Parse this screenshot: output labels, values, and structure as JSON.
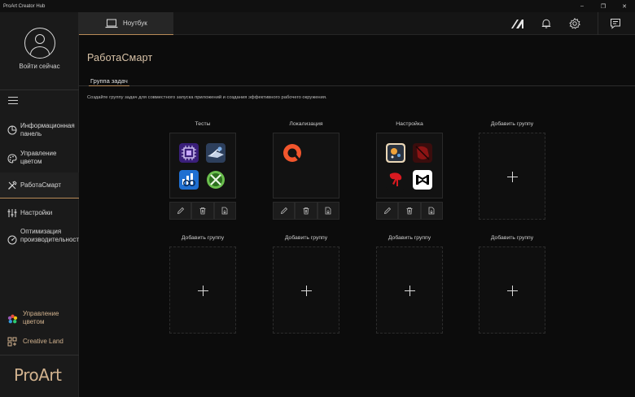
{
  "window": {
    "title": "ProArt Creator Hub",
    "controls": [
      "–",
      "❐",
      "✕"
    ]
  },
  "sidebar": {
    "login_label": "Войти сейчас",
    "items": [
      {
        "label": "Информационная панель",
        "icon": "dashboard-icon"
      },
      {
        "label": "Управление цветом",
        "icon": "palette-icon"
      },
      {
        "label": "РаботаСмарт",
        "icon": "tools-icon",
        "active": true
      },
      {
        "label": "Настройки",
        "icon": "sliders-icon"
      },
      {
        "label": "Оптимизация производительности",
        "icon": "performance-icon"
      }
    ],
    "bottom_items": [
      {
        "label": "Управление цветом",
        "icon": "color-wheel-icon"
      },
      {
        "label": "Creative Land",
        "icon": "creative-land-icon"
      }
    ],
    "logo": "ProArt"
  },
  "topbar": {
    "device_tab": "Ноутбук",
    "icons": [
      "proart-mark-icon",
      "bell-icon",
      "gear-icon",
      "feedback-icon"
    ]
  },
  "page": {
    "title": "РаботаСмарт",
    "subtab": "Группа задач",
    "description": "Создайте группу задач для совместного запуска приложений и создания эффективного рабочего окружения."
  },
  "groups": [
    {
      "name": "Тесты",
      "apps": [
        "cpu-z-icon",
        "3dmark-icon",
        "geekbench-icon",
        "xbox-icon"
      ]
    },
    {
      "name": "Локализация",
      "apps": [
        "qbittorrent-icon"
      ]
    },
    {
      "name": "Настройка",
      "apps": [
        "armoury-crate-icon",
        "mouse-icon",
        "bloody-icon",
        "capcut-icon"
      ]
    }
  ],
  "add_group_label": "Добавить группу",
  "colors": {
    "accent": "#b88a58",
    "background": "#0c0c0c",
    "sidebar": "#1a1a1a"
  }
}
